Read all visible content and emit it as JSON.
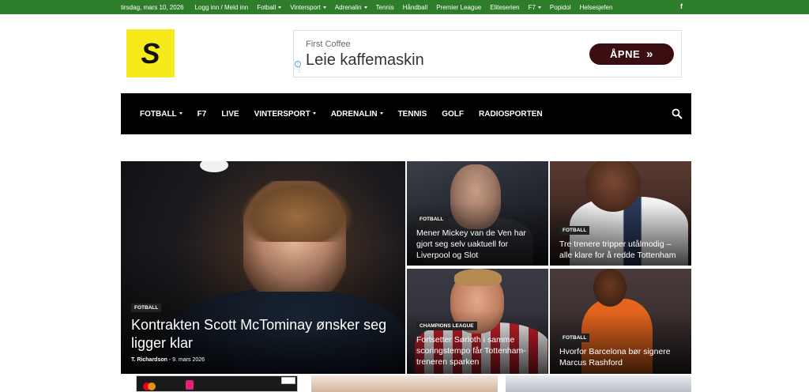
{
  "topbar": {
    "date": "tirsdag, mars 10, 2026",
    "items": [
      {
        "label": "Logg inn / Meld inn",
        "dropdown": false
      },
      {
        "label": "Fotball",
        "dropdown": true
      },
      {
        "label": "Vintersport",
        "dropdown": true
      },
      {
        "label": "Adrenalin",
        "dropdown": true
      },
      {
        "label": "Tennis",
        "dropdown": false
      },
      {
        "label": "Håndball",
        "dropdown": false
      },
      {
        "label": "Premier League",
        "dropdown": false
      },
      {
        "label": "Eliteserien",
        "dropdown": false
      },
      {
        "label": "F7",
        "dropdown": true
      },
      {
        "label": "Popidol",
        "dropdown": false
      },
      {
        "label": "Helsesjefen",
        "dropdown": false
      }
    ],
    "social_icon": "facebook-icon",
    "social_glyph": "f",
    "color": "#2e7d2a"
  },
  "logo": {
    "letter": "S",
    "color": "#f6ea1b"
  },
  "ad": {
    "brand": "First Coffee",
    "headline": "Leie kaffemaskin",
    "cta": "ÅPNE",
    "cta_color": "#3b0f12"
  },
  "mainnav": {
    "items": [
      {
        "label": "FOTBALL",
        "dropdown": true
      },
      {
        "label": "F7",
        "dropdown": false
      },
      {
        "label": "LIVE",
        "dropdown": false
      },
      {
        "label": "VINTERSPORT",
        "dropdown": true
      },
      {
        "label": "ADRENALIN",
        "dropdown": true
      },
      {
        "label": "TENNIS",
        "dropdown": false
      },
      {
        "label": "GOLF",
        "dropdown": false
      },
      {
        "label": "RADIOSPORTEN",
        "dropdown": false
      }
    ],
    "search_icon": "search-icon"
  },
  "featured": {
    "main": {
      "category": "FOTBALL",
      "title": "Kontrakten Scott McTominay ønsker seg ligger klar",
      "author": "T. Richardson",
      "separator": "-",
      "date": "9. mars 2026"
    },
    "tiles": [
      {
        "category": "FOTBALL",
        "title": "Mener Mickey van de Ven har gjort seg selv uaktuell for Liverpool og Slot"
      },
      {
        "category": "FOTBALL",
        "title": "Tre trenere tripper utålmodig – alle klare for å redde Tottenham"
      },
      {
        "category": "CHAMPIONS LEAGUE",
        "title": "Fortsetter Sørloth i samme scoringstempo får Tottenham-treneren sparken"
      },
      {
        "category": "FOTBALL",
        "title": "Hvorfor Barcelona bør signere Marcus Rashford"
      }
    ]
  }
}
